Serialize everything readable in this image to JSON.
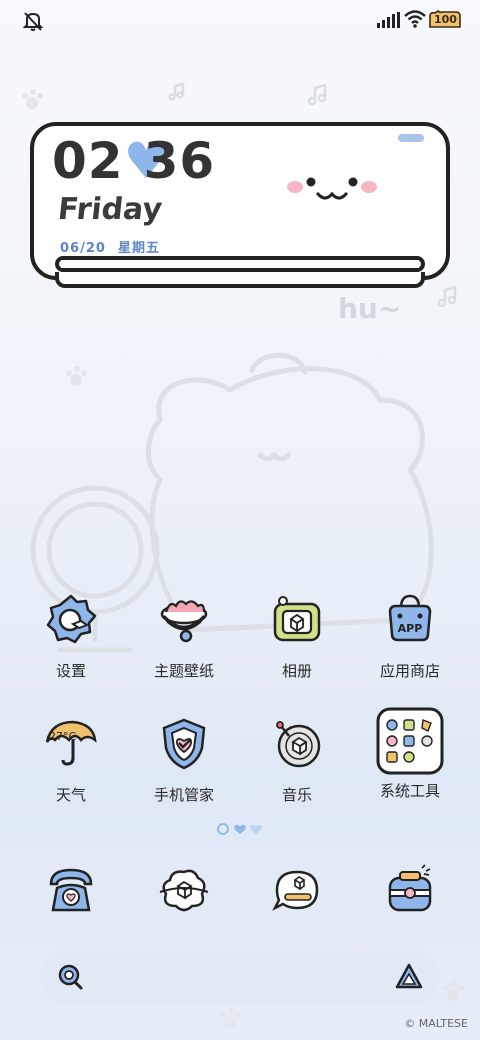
{
  "status_bar": {
    "battery_level": "100"
  },
  "clock_widget": {
    "hours": "02",
    "minutes": "36",
    "weekday_en": "Friday",
    "date": "06/20",
    "weekday_cn": "星期五"
  },
  "decor": {
    "text": "hu~"
  },
  "apps": [
    {
      "label": "设置",
      "icon": "settings-icon"
    },
    {
      "label": "主题壁纸",
      "icon": "theme-icon"
    },
    {
      "label": "相册",
      "icon": "gallery-icon"
    },
    {
      "label": "应用商店",
      "icon": "app-store-icon"
    },
    {
      "label": "天气",
      "icon": "weather-icon",
      "badge": "27°C"
    },
    {
      "label": "手机管家",
      "icon": "security-icon"
    },
    {
      "label": "音乐",
      "icon": "music-icon"
    },
    {
      "label": "系统工具",
      "icon": "system-tools-folder-icon"
    }
  ],
  "dock": [
    {
      "icon": "phone-icon"
    },
    {
      "icon": "contacts-icon"
    },
    {
      "icon": "messages-icon"
    },
    {
      "icon": "camera-icon"
    }
  ],
  "search_bar": {
    "left_icon": "search-icon",
    "right_icon": "assistant-icon"
  },
  "page_indicator": {
    "pages": 3,
    "current": 2
  },
  "colors": {
    "accent_blue": "#8fb6ea",
    "outline": "#222222",
    "background": "#eef3fa"
  },
  "watermark": "© MALTESE"
}
